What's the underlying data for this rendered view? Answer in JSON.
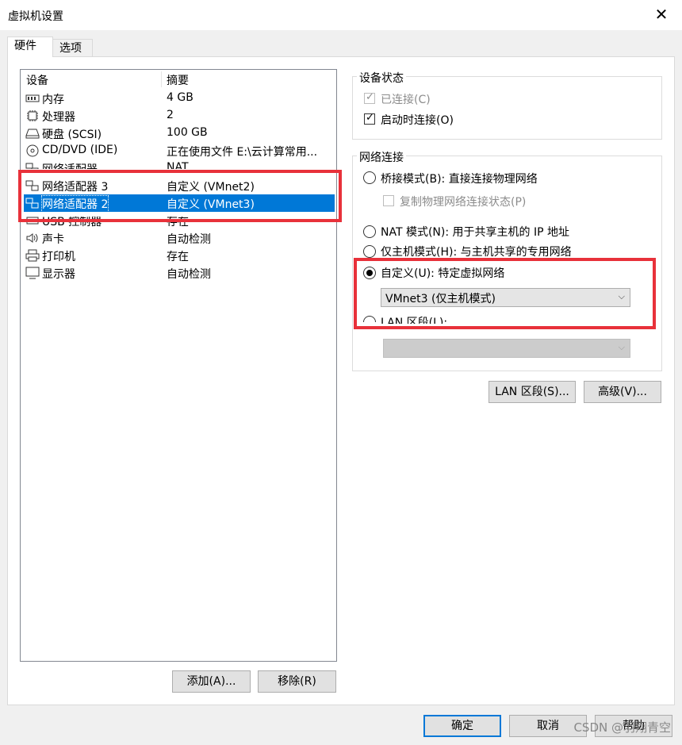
{
  "window": {
    "title": "虚拟机设置",
    "close_glyph": "✕"
  },
  "tabs": [
    {
      "label": "硬件",
      "active": true
    },
    {
      "label": "选项",
      "active": false
    }
  ],
  "device_list": {
    "columns": [
      "设备",
      "摘要"
    ],
    "rows": [
      {
        "label": "内存",
        "summary": "4 GB",
        "icon": "memory-icon"
      },
      {
        "label": "处理器",
        "summary": "2",
        "icon": "cpu-icon"
      },
      {
        "label": "硬盘 (SCSI)",
        "summary": "100 GB",
        "icon": "harddisk-icon"
      },
      {
        "label": "CD/DVD (IDE)",
        "summary": "正在使用文件 E:\\云计算常用...",
        "icon": "cd-dvd-icon"
      },
      {
        "label": "网络适配器",
        "summary": "NAT",
        "icon": "network-adapter-icon"
      },
      {
        "label": "网络适配器 3",
        "summary": "自定义 (VMnet2)",
        "icon": "network-adapter-icon"
      },
      {
        "label": "网络适配器 2",
        "summary": "自定义 (VMnet3)",
        "icon": "network-adapter-icon",
        "selected": true
      },
      {
        "label": "USB 控制器",
        "summary": "存在",
        "icon": "usb-icon"
      },
      {
        "label": "声卡",
        "summary": "自动检测",
        "icon": "speaker-icon"
      },
      {
        "label": "打印机",
        "summary": "存在",
        "icon": "printer-icon"
      },
      {
        "label": "显示器",
        "summary": "自动检测",
        "icon": "monitor-icon"
      }
    ]
  },
  "list_buttons": {
    "add": "添加(A)...",
    "remove": "移除(R)"
  },
  "device_status": {
    "title": "设备状态",
    "connected": {
      "label": "已连接(C)",
      "checked": true,
      "enabled": false
    },
    "connect_at_power_on": {
      "label": "启动时连接(O)",
      "checked": true,
      "enabled": true
    }
  },
  "network_connection": {
    "title": "网络连接",
    "bridged": {
      "label": "桥接模式(B): 直接连接物理网络",
      "selected": false
    },
    "replicate": {
      "label": "复制物理网络连接状态(P)",
      "checked": false,
      "enabled": false
    },
    "nat": {
      "label": "NAT 模式(N): 用于共享主机的 IP 地址",
      "selected": false
    },
    "host_only": {
      "label": "仅主机模式(H): 与主机共享的专用网络",
      "selected": false
    },
    "custom": {
      "label": "自定义(U): 特定虚拟网络",
      "selected": true,
      "value": "VMnet3 (仅主机模式)"
    },
    "lan_segment": {
      "label": "LAN 区段(L):",
      "selected": false,
      "value": ""
    }
  },
  "right_buttons": {
    "lan_segments": "LAN 区段(S)...",
    "advanced": "高级(V)..."
  },
  "dialog_buttons": {
    "ok": "确定",
    "cancel": "取消",
    "help": "帮助"
  },
  "watermark": "CSDN @羽翔青空",
  "colors": {
    "selection": "#0078d7",
    "highlight_box": "#e8313a"
  }
}
